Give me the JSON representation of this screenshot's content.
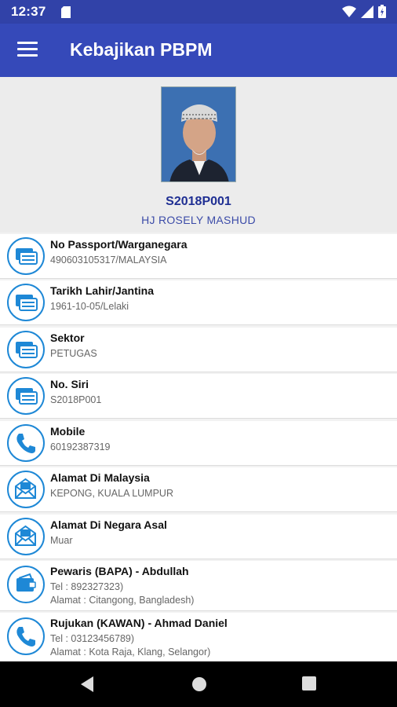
{
  "status": {
    "time": "12:37"
  },
  "appbar": {
    "title": "Kebajikan PBPM"
  },
  "profile": {
    "id": "S2018P001",
    "name": "HJ ROSELY MASHUD"
  },
  "items": [
    {
      "icon": "id-card-icon",
      "label": "No Passport/Warganegara",
      "value": "490603105317/MALAYSIA"
    },
    {
      "icon": "id-card-icon",
      "label": "Tarikh Lahir/Jantina",
      "value": "1961-10-05/Lelaki"
    },
    {
      "icon": "id-card-icon",
      "label": "Sektor",
      "value": "PETUGAS"
    },
    {
      "icon": "id-card-icon",
      "label": "No. Siri",
      "value": "S2018P001"
    },
    {
      "icon": "phone-icon",
      "label": "Mobile",
      "value": "60192387319"
    },
    {
      "icon": "mail-icon",
      "label": "Alamat Di Malaysia",
      "value": "KEPONG, KUALA LUMPUR"
    },
    {
      "icon": "mail-icon",
      "label": "Alamat Di Negara Asal",
      "value": "Muar"
    },
    {
      "icon": "wallet-icon",
      "label": "Pewaris (BAPA) - Abdullah",
      "value": "Tel : 892327323)",
      "value2": "Alamat : Citangong, Bangladesh)"
    },
    {
      "icon": "phone-icon",
      "label": "Rujukan (KAWAN) - Ahmad Daniel",
      "value": "Tel : 03123456789)",
      "value2": "Alamat : Kota Raja, Klang, Selangor)"
    }
  ],
  "colors": {
    "primary": "#3549b9",
    "status_bar": "#3142a8",
    "accent": "#1e88d6"
  }
}
